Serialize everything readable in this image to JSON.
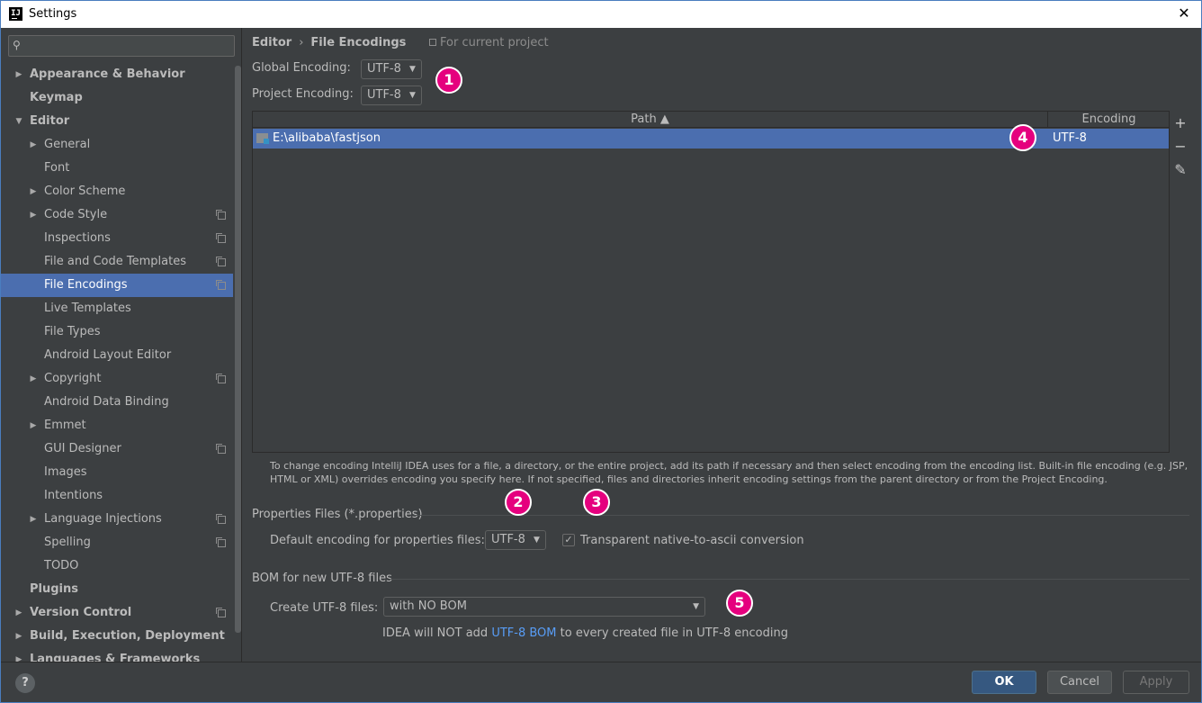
{
  "window": {
    "title": "Settings",
    "close_glyph": "✕",
    "app_icon_text": "IJ"
  },
  "sidebar": {
    "search": {
      "value": "",
      "placeholder": ""
    },
    "items": [
      {
        "label": "Appearance & Behavior",
        "level": 0,
        "arrow": "▶",
        "proj": false,
        "selected": false
      },
      {
        "label": "Keymap",
        "level": 0,
        "arrow": "",
        "proj": false,
        "selected": false
      },
      {
        "label": "Editor",
        "level": 0,
        "arrow": "▼",
        "proj": false,
        "selected": false
      },
      {
        "label": "General",
        "level": 1,
        "arrow": "▶",
        "proj": false,
        "selected": false
      },
      {
        "label": "Font",
        "level": 1,
        "arrow": "",
        "proj": false,
        "selected": false
      },
      {
        "label": "Color Scheme",
        "level": 1,
        "arrow": "▶",
        "proj": false,
        "selected": false
      },
      {
        "label": "Code Style",
        "level": 1,
        "arrow": "▶",
        "proj": true,
        "selected": false
      },
      {
        "label": "Inspections",
        "level": 1,
        "arrow": "",
        "proj": true,
        "selected": false
      },
      {
        "label": "File and Code Templates",
        "level": 1,
        "arrow": "",
        "proj": true,
        "selected": false
      },
      {
        "label": "File Encodings",
        "level": 1,
        "arrow": "",
        "proj": true,
        "selected": true
      },
      {
        "label": "Live Templates",
        "level": 1,
        "arrow": "",
        "proj": false,
        "selected": false
      },
      {
        "label": "File Types",
        "level": 1,
        "arrow": "",
        "proj": false,
        "selected": false
      },
      {
        "label": "Android Layout Editor",
        "level": 1,
        "arrow": "",
        "proj": false,
        "selected": false
      },
      {
        "label": "Copyright",
        "level": 1,
        "arrow": "▶",
        "proj": true,
        "selected": false
      },
      {
        "label": "Android Data Binding",
        "level": 1,
        "arrow": "",
        "proj": false,
        "selected": false
      },
      {
        "label": "Emmet",
        "level": 1,
        "arrow": "▶",
        "proj": false,
        "selected": false
      },
      {
        "label": "GUI Designer",
        "level": 1,
        "arrow": "",
        "proj": true,
        "selected": false
      },
      {
        "label": "Images",
        "level": 1,
        "arrow": "",
        "proj": false,
        "selected": false
      },
      {
        "label": "Intentions",
        "level": 1,
        "arrow": "",
        "proj": false,
        "selected": false
      },
      {
        "label": "Language Injections",
        "level": 1,
        "arrow": "▶",
        "proj": true,
        "selected": false
      },
      {
        "label": "Spelling",
        "level": 1,
        "arrow": "",
        "proj": true,
        "selected": false
      },
      {
        "label": "TODO",
        "level": 1,
        "arrow": "",
        "proj": false,
        "selected": false
      },
      {
        "label": "Plugins",
        "level": 0,
        "arrow": "",
        "proj": false,
        "selected": false
      },
      {
        "label": "Version Control",
        "level": 0,
        "arrow": "▶",
        "proj": true,
        "selected": false
      },
      {
        "label": "Build, Execution, Deployment",
        "level": 0,
        "arrow": "▶",
        "proj": false,
        "selected": false
      },
      {
        "label": "Languages & Frameworks",
        "level": 0,
        "arrow": "▶",
        "proj": false,
        "selected": false
      }
    ]
  },
  "main": {
    "breadcrumb": {
      "parent": "Editor",
      "separator": "›",
      "current": "File Encodings"
    },
    "scope_label": "For current project",
    "global_encoding": {
      "label": "Global Encoding:",
      "value": "UTF-8"
    },
    "project_encoding": {
      "label": "Project Encoding:",
      "value": "UTF-8"
    },
    "table": {
      "columns": {
        "path": "Path ▲",
        "encoding": "Encoding"
      },
      "rows": [
        {
          "path": "E:\\alibaba\\fastjson",
          "encoding": "UTF-8"
        }
      ],
      "tools": {
        "add": "+",
        "remove": "−",
        "edit": "✎"
      }
    },
    "hint": "To change encoding IntelliJ IDEA uses for a file, a directory, or the entire project, add its path if necessary and then select encoding from the encoding list. Built-in file encoding (e.g. JSP, HTML or XML) overrides encoding you specify here. If not specified, files and directories inherit encoding settings from the parent directory or from the Project Encoding.",
    "properties": {
      "title": "Properties Files (*.properties)",
      "default_label": "Default encoding for properties files:",
      "default_value": "UTF-8",
      "transparent_label": "Transparent native-to-ascii conversion",
      "transparent_checked": "✓"
    },
    "bom": {
      "title": "BOM for new UTF-8 files",
      "create_label": "Create UTF-8 files:",
      "create_value": "with NO BOM",
      "note_prefix": "IDEA will NOT add ",
      "note_link": "UTF-8 BOM",
      "note_suffix": " to every created file in UTF-8 encoding"
    },
    "badges": [
      "1",
      "2",
      "3",
      "4",
      "5"
    ]
  },
  "footer": {
    "help": "?",
    "ok": "OK",
    "cancel": "Cancel",
    "apply": "Apply"
  },
  "colors": {
    "accent": "#4b6eaf",
    "badge": "#e5007e",
    "link": "#589df6",
    "ok_button": "#365880"
  }
}
